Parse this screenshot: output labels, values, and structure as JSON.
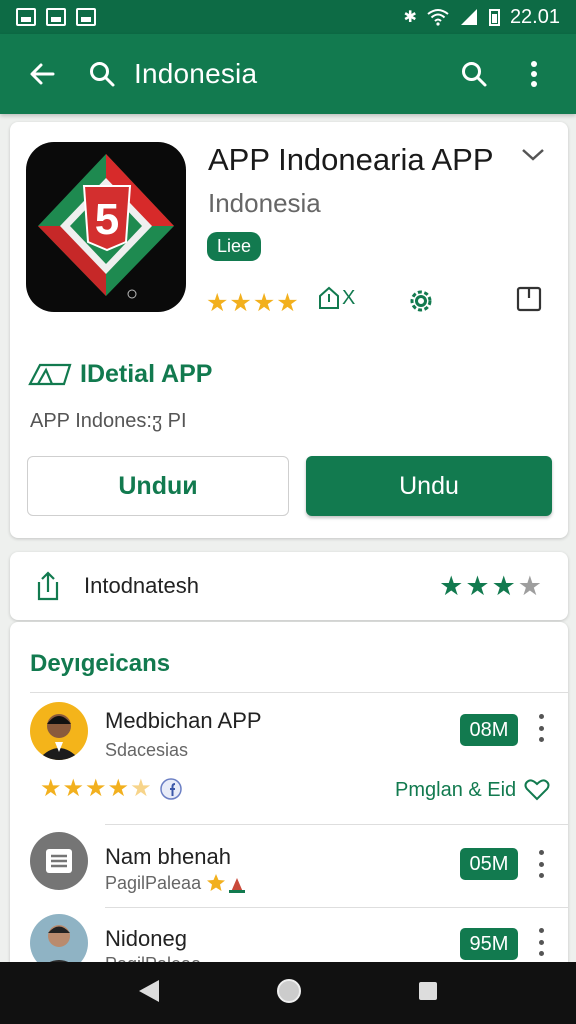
{
  "status_bar": {
    "time": "22.01"
  },
  "app_bar": {
    "title": "Indonesia"
  },
  "app": {
    "icon_mark": "5",
    "title": "APP Indonearia APP",
    "subtitle": "Indonesia",
    "badge": "Liee",
    "rating_stars": "★★★★",
    "age_label": "X",
    "detail_link": "IDetial APP",
    "description": "APP Indones:ჳ PI",
    "buttons": {
      "secondary": "Unduи",
      "primary": "Undu"
    }
  },
  "share_row": {
    "label": "Intodnatesh",
    "stars_filled": "★★★",
    "stars_empty": "★"
  },
  "list": {
    "title": "Deyıgeicans",
    "items": [
      {
        "title": "Medbichan APP",
        "subtitle": "Sdacesias",
        "size": "08M",
        "stars": "★★★★",
        "half_star": "★",
        "extra_link": "Pmglan & Eid"
      },
      {
        "title": "Nam bhenah",
        "subtitle": "PagilPaleaa",
        "size": "05M"
      },
      {
        "title": "Nidoneg",
        "subtitle": "PagilPaleaa",
        "size": "95M"
      }
    ]
  },
  "colors": {
    "primary": "#127a4f",
    "status_bar": "#0d6b45",
    "star": "#f2b01e",
    "nav_bar": "#111111"
  },
  "icons": [
    "back-arrow-icon",
    "search-icon",
    "more-vert-icon",
    "chevron-down-icon",
    "settings-gear-icon",
    "bookmark-icon",
    "share-icon",
    "heart-icon"
  ]
}
